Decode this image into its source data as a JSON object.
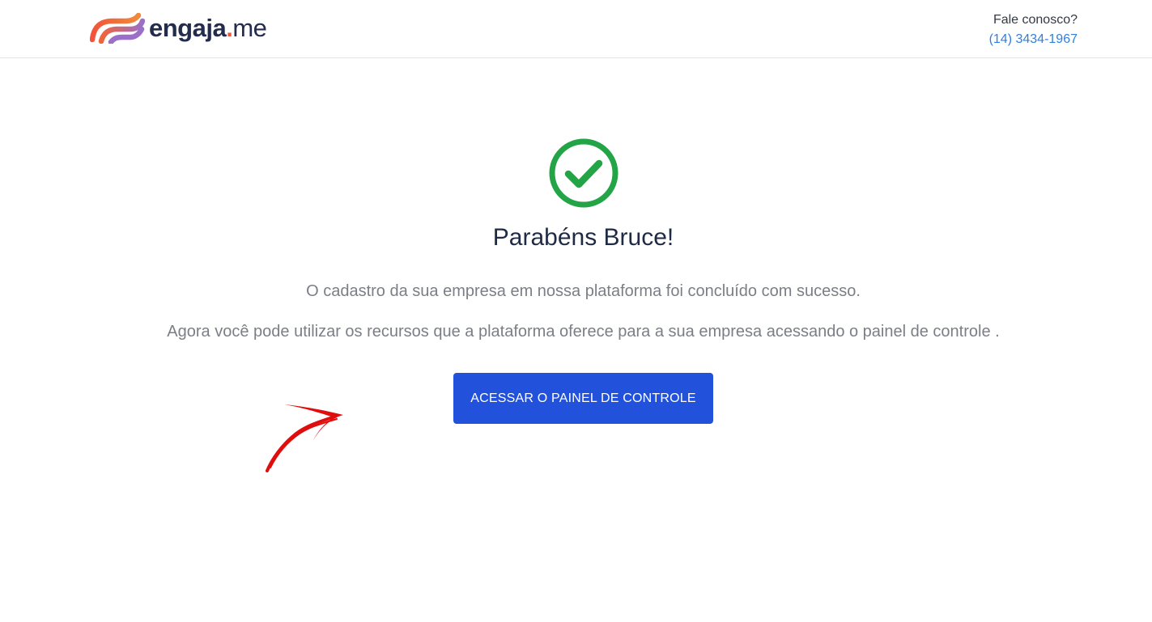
{
  "header": {
    "logo": {
      "brand": "engaja",
      "dot": ".",
      "tld": "me",
      "icon": "engaja-logo-mark"
    },
    "contact": {
      "label": "Fale conosco?",
      "phone": "(14) 3434-1967"
    }
  },
  "main": {
    "status_icon": "check-circle-icon",
    "title": "Parabéns Bruce!",
    "message_1": "O cadastro da sua empresa em nossa plataforma foi concluído com sucesso.",
    "message_2": "Agora você pode utilizar os recursos que a plataforma oferece para a sua empresa acessando o painel de controle .",
    "cta_label": "ACESSAR O PAINEL DE CONTROLE",
    "annotation_icon": "red-arrow-icon"
  },
  "colors": {
    "brand_navy": "#242c4e",
    "brand_orange": "#f0573a",
    "brand_purple": "#9b6fc9",
    "success_green": "#22a447",
    "primary_button": "#2251dc",
    "link_blue": "#2f7fe0",
    "annotation_red": "#e00d0d"
  }
}
